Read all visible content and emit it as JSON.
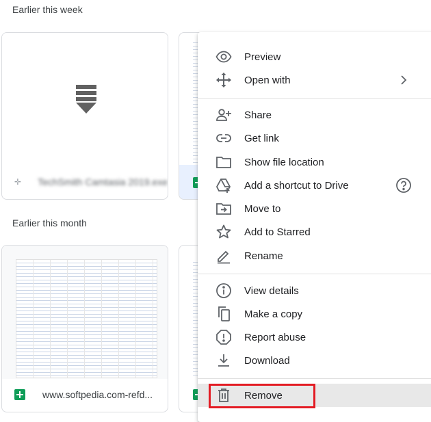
{
  "sections": {
    "week_title": "Earlier this week",
    "month_title": "Earlier this month"
  },
  "cards": {
    "card1_name": "TechSmith Camtasia 2019.exe",
    "card3_name": "www.softpedia.com-refd..."
  },
  "menu": {
    "preview": "Preview",
    "open_with": "Open with",
    "share": "Share",
    "get_link": "Get link",
    "show_file_location": "Show file location",
    "add_shortcut": "Add a shortcut to Drive",
    "move_to": "Move to",
    "add_starred": "Add to Starred",
    "rename": "Rename",
    "view_details": "View details",
    "make_copy": "Make a copy",
    "report_abuse": "Report abuse",
    "download": "Download",
    "remove": "Remove"
  },
  "colors": {
    "icon": "#5f6368",
    "sheets_green": "#0f9d58",
    "highlight_red": "#e31b23",
    "hover_gray": "#e8e8e8"
  }
}
